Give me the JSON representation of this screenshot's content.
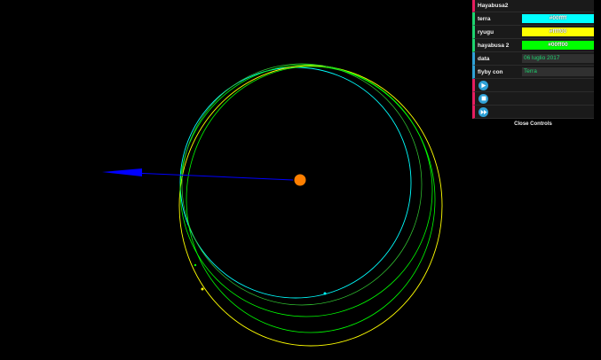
{
  "gui": {
    "folder_title": "Hayabusa2",
    "close_label": "Close Controls",
    "controls": [
      {
        "key": "terra",
        "label": "terra",
        "value": "#00ffff",
        "color": "#00ffff"
      },
      {
        "key": "ryugu",
        "label": "ryugu",
        "value": "#ffff00",
        "color": "#ffff00"
      },
      {
        "key": "hayabusa",
        "label": "hayabusa 2",
        "value": "#00ff00",
        "color": "#00ff00"
      }
    ],
    "data_label": "data",
    "data_value": "06 luglio 2017",
    "flyby_label": "flyby con",
    "flyby_value": "Terra",
    "buttons": [
      "play",
      "stop",
      "fast-forward"
    ]
  },
  "scene": {
    "sun_color": "#ff7f00",
    "earth_orbit_color": "#00ffff",
    "ryugu_orbit_color": "#ffff00",
    "hayabusa_orbit_color": "#00ff00",
    "arrow_color": "#0000ff"
  }
}
